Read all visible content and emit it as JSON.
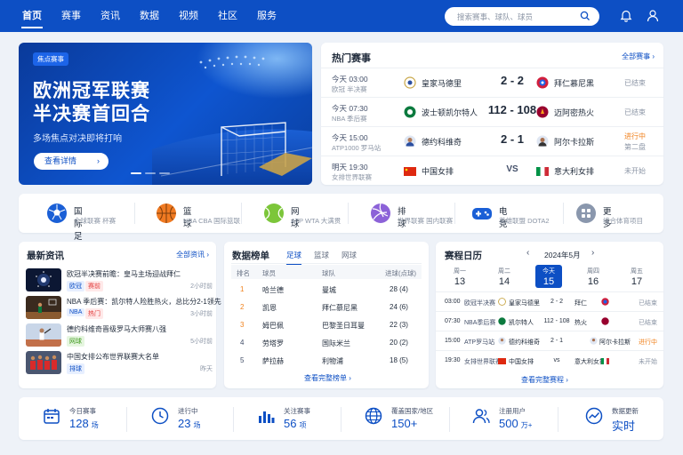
{
  "nav": {
    "items": [
      "首页",
      "赛事",
      "资讯",
      "数据",
      "视频",
      "社区",
      "服务"
    ],
    "active_index": 0,
    "search_placeholder": "搜索赛事、球队、球员",
    "brand_color": "#0d4fc4"
  },
  "banner": {
    "tag": "焦点赛事",
    "title_line1": "欧洲冠军联赛",
    "title_line2": "半决赛首回合",
    "subtitle": "多场焦点对决即将打响",
    "button": "查看详情",
    "slides": 3,
    "active_slide": 0
  },
  "hot": {
    "title": "热门赛事",
    "more": "全部赛事",
    "matches": [
      {
        "time": "今天 03:00",
        "league": "欧冠 半决赛",
        "home": "皇家马德里",
        "score": "2 - 2",
        "away": "拜仁慕尼黑",
        "status": "已结束",
        "half": ""
      },
      {
        "time": "今天 07:30",
        "league": "NBA 季后赛",
        "home": "波士顿凯尔特人",
        "score": "112 - 108",
        "away": "迈阿密热火",
        "status": "已结束",
        "half": ""
      },
      {
        "time": "今天 15:00",
        "league": "ATP1000 罗马站",
        "home": "德约科维奇",
        "score": "2 - 1",
        "away": "阿尔卡拉斯",
        "status": "进行中",
        "half": "第二盘"
      },
      {
        "time": "明天 19:30",
        "league": "女排世界联赛",
        "home": "中国女排",
        "score": "VS",
        "away": "意大利女排",
        "status": "未开始",
        "half": ""
      }
    ]
  },
  "categories": [
    {
      "name": "国际足球",
      "sub": "全球联赛  杯赛",
      "icon": "football-icon",
      "color": "#1a5fd6"
    },
    {
      "name": "篮球",
      "sub": "NBA  CBA  国际篮联",
      "icon": "basketball-icon",
      "color": "#f07a22"
    },
    {
      "name": "网球",
      "sub": "ATP  WTA  大满贯",
      "icon": "tennis-icon",
      "color": "#7cc63a"
    },
    {
      "name": "排球",
      "sub": "世界联赛  国内联赛",
      "icon": "volleyball-icon",
      "color": "#8c62d8"
    },
    {
      "name": "电竞",
      "sub": "英雄联盟  DOTA2",
      "icon": "gamepad-icon",
      "color": "#1a5fd6"
    },
    {
      "name": "更多",
      "sub": "综合体育项目",
      "icon": "grid-icon",
      "color": "#8a97ad"
    }
  ],
  "news": {
    "title": "最新资讯",
    "more": "全部资讯",
    "items": [
      {
        "title": "欧冠半决赛前瞻：皇马主场迎战拜仁",
        "tags": [
          {
            "text": "欧冠",
            "kind": "blue"
          },
          {
            "text": "赛前",
            "kind": "red"
          }
        ],
        "time": "2小时前"
      },
      {
        "title": "NBA 季后赛：凯尔特人险胜热火，总比分2-1领先",
        "tags": [
          {
            "text": "NBA",
            "kind": "blue"
          },
          {
            "text": "热门",
            "kind": "red"
          }
        ],
        "time": "3小时前"
      },
      {
        "title": "德约科维奇晋级罗马大师赛八强",
        "tags": [
          {
            "text": "网球",
            "kind": "green"
          }
        ],
        "time": "5小时前"
      },
      {
        "title": "中国女排公布世界联赛大名单",
        "tags": [
          {
            "text": "排球",
            "kind": "blue"
          }
        ],
        "time": "昨天"
      }
    ]
  },
  "ranking": {
    "title": "数据榜单",
    "tabs": [
      "足球",
      "篮球",
      "网球"
    ],
    "active_tab": 0,
    "headers": [
      "排名",
      "球员",
      "球队",
      "进球(点球)"
    ],
    "rows": [
      {
        "rank": "1",
        "player": "哈兰德",
        "team": "曼城",
        "goals": "28 (4)"
      },
      {
        "rank": "2",
        "player": "凯恩",
        "team": "拜仁慕尼黑",
        "goals": "24 (6)"
      },
      {
        "rank": "3",
        "player": "姆巴佩",
        "team": "巴黎圣日耳曼",
        "goals": "22 (3)"
      },
      {
        "rank": "4",
        "player": "劳塔罗",
        "team": "国际米兰",
        "goals": "20 (2)"
      },
      {
        "rank": "5",
        "player": "萨拉赫",
        "team": "利物浦",
        "goals": "18 (5)"
      }
    ],
    "more": "查看完整榜单"
  },
  "calendar": {
    "title": "赛程日历",
    "month": "2024年5月",
    "days": [
      {
        "w": "周一",
        "d": "13"
      },
      {
        "w": "周二",
        "d": "14"
      },
      {
        "w": "今天",
        "d": "15"
      },
      {
        "w": "周四",
        "d": "16"
      },
      {
        "w": "周五",
        "d": "17"
      }
    ],
    "active_day": 2,
    "events": [
      {
        "time": "03:00",
        "league": "欧冠半决赛",
        "home": "皇家马德里",
        "score": "2 - 2",
        "away": "拜仁",
        "status": "已结束"
      },
      {
        "time": "07:30",
        "league": "NBA季后赛",
        "home": "凯尔特人",
        "score": "112 - 108",
        "away": "热火",
        "status": "已结束"
      },
      {
        "time": "15:00",
        "league": "ATP罗马站",
        "home": "德约科维奇",
        "score": "2 - 1",
        "away": "阿尔卡拉斯",
        "status": "进行中"
      },
      {
        "time": "19:30",
        "league": "女排世界联赛",
        "home": "中国女排",
        "score": "vs",
        "away": "意大利女排",
        "status": "未开始"
      }
    ],
    "more": "查看完整赛程"
  },
  "stats": [
    {
      "label": "今日赛事",
      "value": "128",
      "unit": "场",
      "icon": "calendar-icon"
    },
    {
      "label": "进行中",
      "value": "23",
      "unit": "场",
      "icon": "clock-icon"
    },
    {
      "label": "关注赛事",
      "value": "56",
      "unit": "项",
      "icon": "bar-chart-icon"
    },
    {
      "label": "覆盖国家/地区",
      "value": "150+",
      "unit": "",
      "icon": "globe-icon"
    },
    {
      "label": "注册用户",
      "value": "500",
      "unit": "万+",
      "icon": "users-icon"
    },
    {
      "label": "数据更新",
      "value": "实时",
      "unit": "",
      "icon": "trend-icon"
    }
  ]
}
